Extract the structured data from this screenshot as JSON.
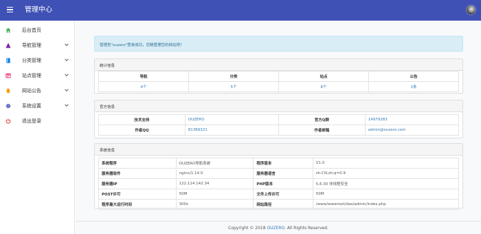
{
  "app": {
    "title": "管理中心"
  },
  "sidebar": {
    "items": [
      {
        "label": "后台首页",
        "icon": "home-icon",
        "color": "#4caf50"
      },
      {
        "label": "导航管理",
        "icon": "triangle-icon",
        "color": "#7b1fa2"
      },
      {
        "label": "分类管理",
        "icon": "book-icon",
        "color": "#1e88e5"
      },
      {
        "label": "站点管理",
        "icon": "window-icon",
        "color": "#e91e63"
      },
      {
        "label": "网站公告",
        "icon": "bell-icon",
        "color": "#ff9800"
      },
      {
        "label": "系统设置",
        "icon": "gear-icon",
        "color": "#3f51b5"
      },
      {
        "label": "退出登录",
        "icon": "power-icon",
        "color": "#e53935"
      }
    ]
  },
  "alert": {
    "text": "管理员\"ouzero\"登录成功，您精管理您的网站吧！"
  },
  "stats": {
    "title": "统计信息",
    "headers": [
      "导航",
      "分类",
      "站点",
      "公告"
    ],
    "values": [
      "4个",
      "5个",
      "8个",
      "1条"
    ]
  },
  "official": {
    "title": "官方信息",
    "rows": [
      {
        "label1": "技术支持",
        "value1": "OUZERO",
        "label2": "官方Q群",
        "value2": "14979283"
      },
      {
        "label1": "作者QQ",
        "value1": "81389321",
        "label2": "作者邮箱",
        "value2": "admin@ouzero.com"
      }
    ]
  },
  "system": {
    "title": "系统信息",
    "rows": [
      {
        "label1": "系统程序",
        "value1": "OUZERO导航系统",
        "label2": "程序版本",
        "value2": "V1.0"
      },
      {
        "label1": "服务器软件",
        "value1": "nginx/1.14.0",
        "label2": "服务器语言",
        "value2": "zh-CN,zh;q=0.9"
      },
      {
        "label1": "服务器IP",
        "value1": "122.114.142.34",
        "label2": "PHP版本",
        "value2": "5.6.30 非线程安全"
      },
      {
        "label1": "POST许可",
        "value1": "50M",
        "label2": "文件上传许可",
        "value2": "50M"
      },
      {
        "label1": "程序最大运行时间",
        "value1": "300s",
        "label2": "网站路径",
        "value2": "/www/wwwroot/dao/admin/index.php"
      }
    ]
  },
  "footer": {
    "prefix": "Copyright © 2018 ",
    "brand": "OUZERO",
    "suffix": ". All Rights Reserved."
  },
  "colors": {
    "primary": "#3f51b5",
    "link": "#337ab7",
    "alert_bg": "#d9edf7"
  }
}
